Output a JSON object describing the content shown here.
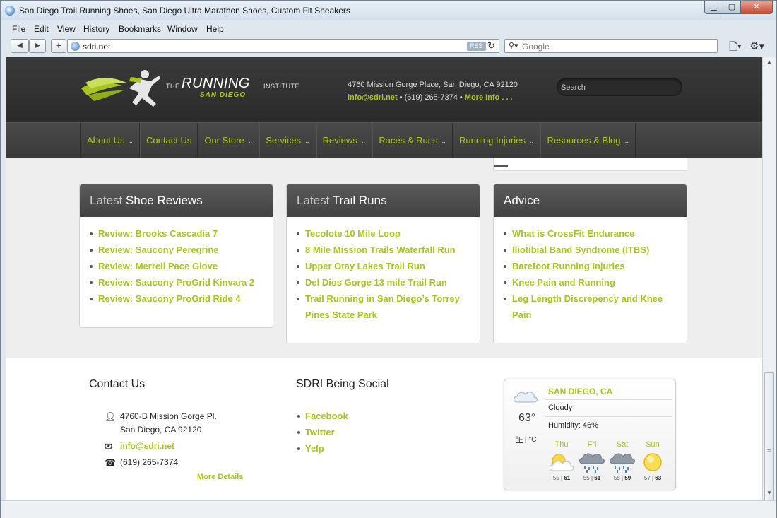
{
  "window": {
    "title": "San Diego Trail Running Shoes, San Diego Ultra Marathon Shoes, Custom Fit Sneakers"
  },
  "menubar": [
    "File",
    "Edit",
    "View",
    "History",
    "Bookmarks",
    "Window",
    "Help"
  ],
  "toolbar": {
    "url": "sdri.net",
    "rss": "RSS",
    "search_placeholder": "Google"
  },
  "site": {
    "logo": {
      "the": "THE",
      "running": "RUNNING",
      "institute": "INSTITUTE",
      "sandiego": "SAN DIEGO"
    },
    "address": "4760 Mission Gorge Place, San Diego, CA 92120",
    "email": "info@sdri.net",
    "phone": " • (619) 265-7374 •",
    "more_info": "More Info . . .",
    "search_placeholder": "Search"
  },
  "nav": [
    "About Us",
    "Contact Us",
    "Our Store",
    "Services",
    "Reviews",
    "Races & Runs",
    "Running Injuries",
    "Resources & Blog"
  ],
  "panels": [
    {
      "title_light": "Latest",
      "title_bold": "Shoe Reviews",
      "items": [
        "Review: Brooks Cascadia 7",
        "Review: Saucony Peregrine",
        "Review: Merrell Pace Glove",
        "Review: Saucony ProGrid Kinvara 2",
        "Review: Saucony ProGrid Ride 4"
      ]
    },
    {
      "title_light": "Latest",
      "title_bold": "Trail Runs",
      "items": [
        "Tecolote 10 Mile Loop",
        "8 Mile Mission Trails Waterfall Run",
        "Upper Otay Lakes Trail Run",
        "Del Dios Gorge 13 mile Trail Run",
        "Trail Running in San Diego’s Torrey Pines State Park"
      ]
    },
    {
      "title_light": "",
      "title_bold": "Advice",
      "items": [
        "What is CrossFit Endurance",
        "Iliotibial Band Syndrome (ITBS)",
        "Barefoot Running Injuries",
        "Knee Pain and Running",
        "Leg Length Discrepency and Knee Pain"
      ]
    }
  ],
  "footer": {
    "contact_title": "Contact Us",
    "addr1": "4760-B Mission Gorge Pl.",
    "addr2": "San Diego, CA 92120",
    "email": "info@sdri.net",
    "phone": "(619) 265-7374",
    "more": "More Details",
    "social_title": "SDRI Being Social",
    "social": [
      "Facebook",
      "Twitter",
      "Yelp"
    ]
  },
  "weather": {
    "city": "SAN DIEGO, CA",
    "temp": "63°",
    "unit_f": "°F",
    "unit_sep": " | ",
    "unit_c": "°C",
    "condition": "Cloudy",
    "humidity": "Humidity: 46%",
    "days": [
      {
        "name": "Thu",
        "low": "55",
        "high": "61",
        "icon": "partly-cloudy-icon"
      },
      {
        "name": "Fri",
        "low": "55",
        "high": "61",
        "icon": "rain-cloud-icon"
      },
      {
        "name": "Sat",
        "low": "55",
        "high": "59",
        "icon": "rain-cloud-icon"
      },
      {
        "name": "Sun",
        "low": "57",
        "high": "63",
        "icon": "sun-icon"
      }
    ]
  },
  "colors": {
    "accent": "#a8c51f",
    "header": "#333333"
  }
}
